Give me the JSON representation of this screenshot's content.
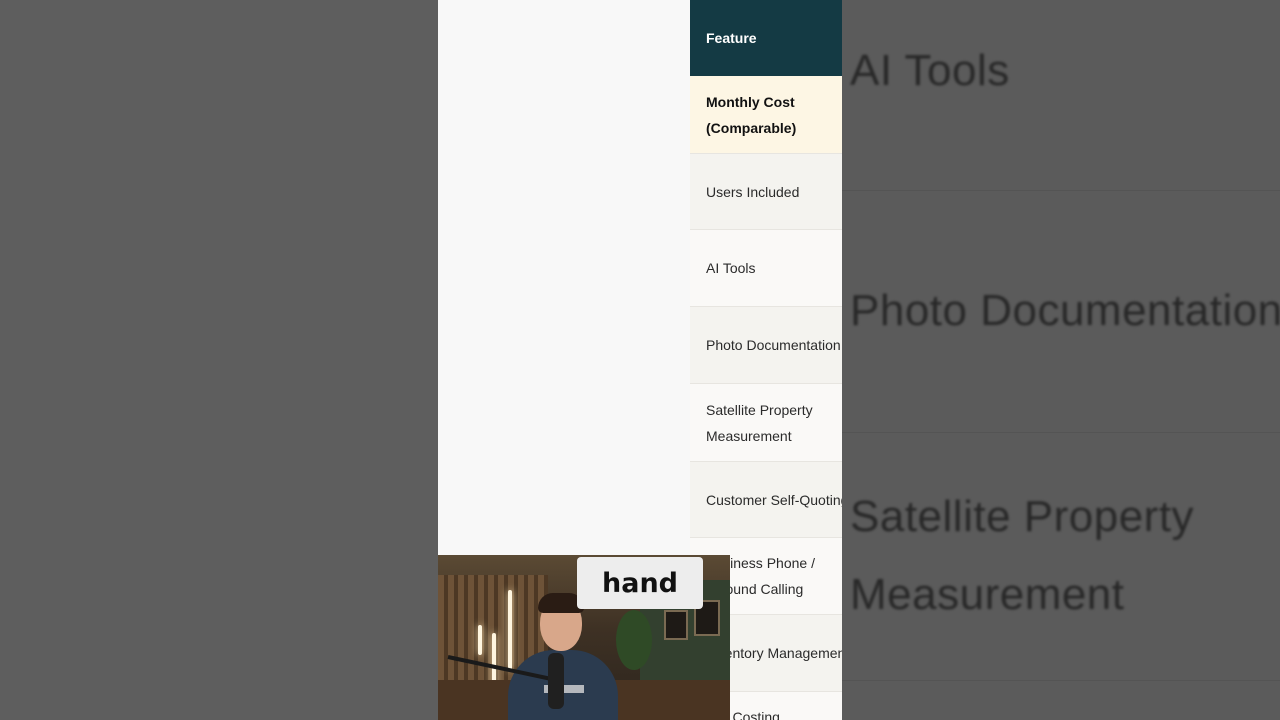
{
  "table": {
    "header": "Feature",
    "rows": [
      {
        "label": "Monthly Cost (Comparable)",
        "style": "highlight"
      },
      {
        "label": "Users Included",
        "style": "alt"
      },
      {
        "label": "AI Tools",
        "style": "plain"
      },
      {
        "label": "Photo Documentation",
        "style": "alt"
      },
      {
        "label": "Satellite Property Measurement",
        "style": "plain"
      },
      {
        "label": "Customer Self-Quoting",
        "style": "alt"
      },
      {
        "label": "Business Phone / Inbound Calling",
        "style": "plain"
      },
      {
        "label": "Inventory Management",
        "style": "alt"
      },
      {
        "label": "Job Costing",
        "style": "plain"
      }
    ]
  },
  "background_mirror": {
    "lines": [
      "AI Tools",
      "Photo Documentation",
      "Satellite Property",
      "Measurement"
    ]
  },
  "caption": {
    "text": "hand"
  },
  "colors": {
    "header_bg": "#143a44",
    "highlight_bg": "#fdf6e4",
    "caption_bg": "#ededed"
  }
}
